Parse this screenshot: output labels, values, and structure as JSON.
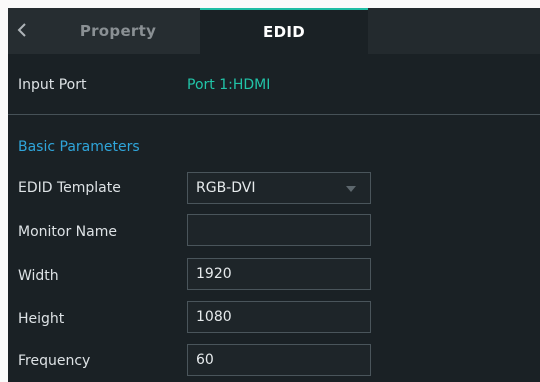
{
  "tabs": {
    "back_icon": "chevron-left-icon",
    "property_label": "Property",
    "edid_label": "EDID"
  },
  "input_port": {
    "label": "Input Port",
    "value": "Port 1:HDMI"
  },
  "basic_parameters": {
    "title": "Basic Parameters",
    "edid_template": {
      "label": "EDID Template",
      "value": "RGB-DVI"
    },
    "monitor_name": {
      "label": "Monitor Name",
      "value": ""
    },
    "width": {
      "label": "Width",
      "value": "1920"
    },
    "height": {
      "label": "Height",
      "value": "1080"
    },
    "frequency": {
      "label": "Frequency",
      "value": "60"
    }
  },
  "colors": {
    "accent_teal": "#21c4a8",
    "section_blue": "#2fa5da",
    "panel_bg": "#1a2125"
  }
}
